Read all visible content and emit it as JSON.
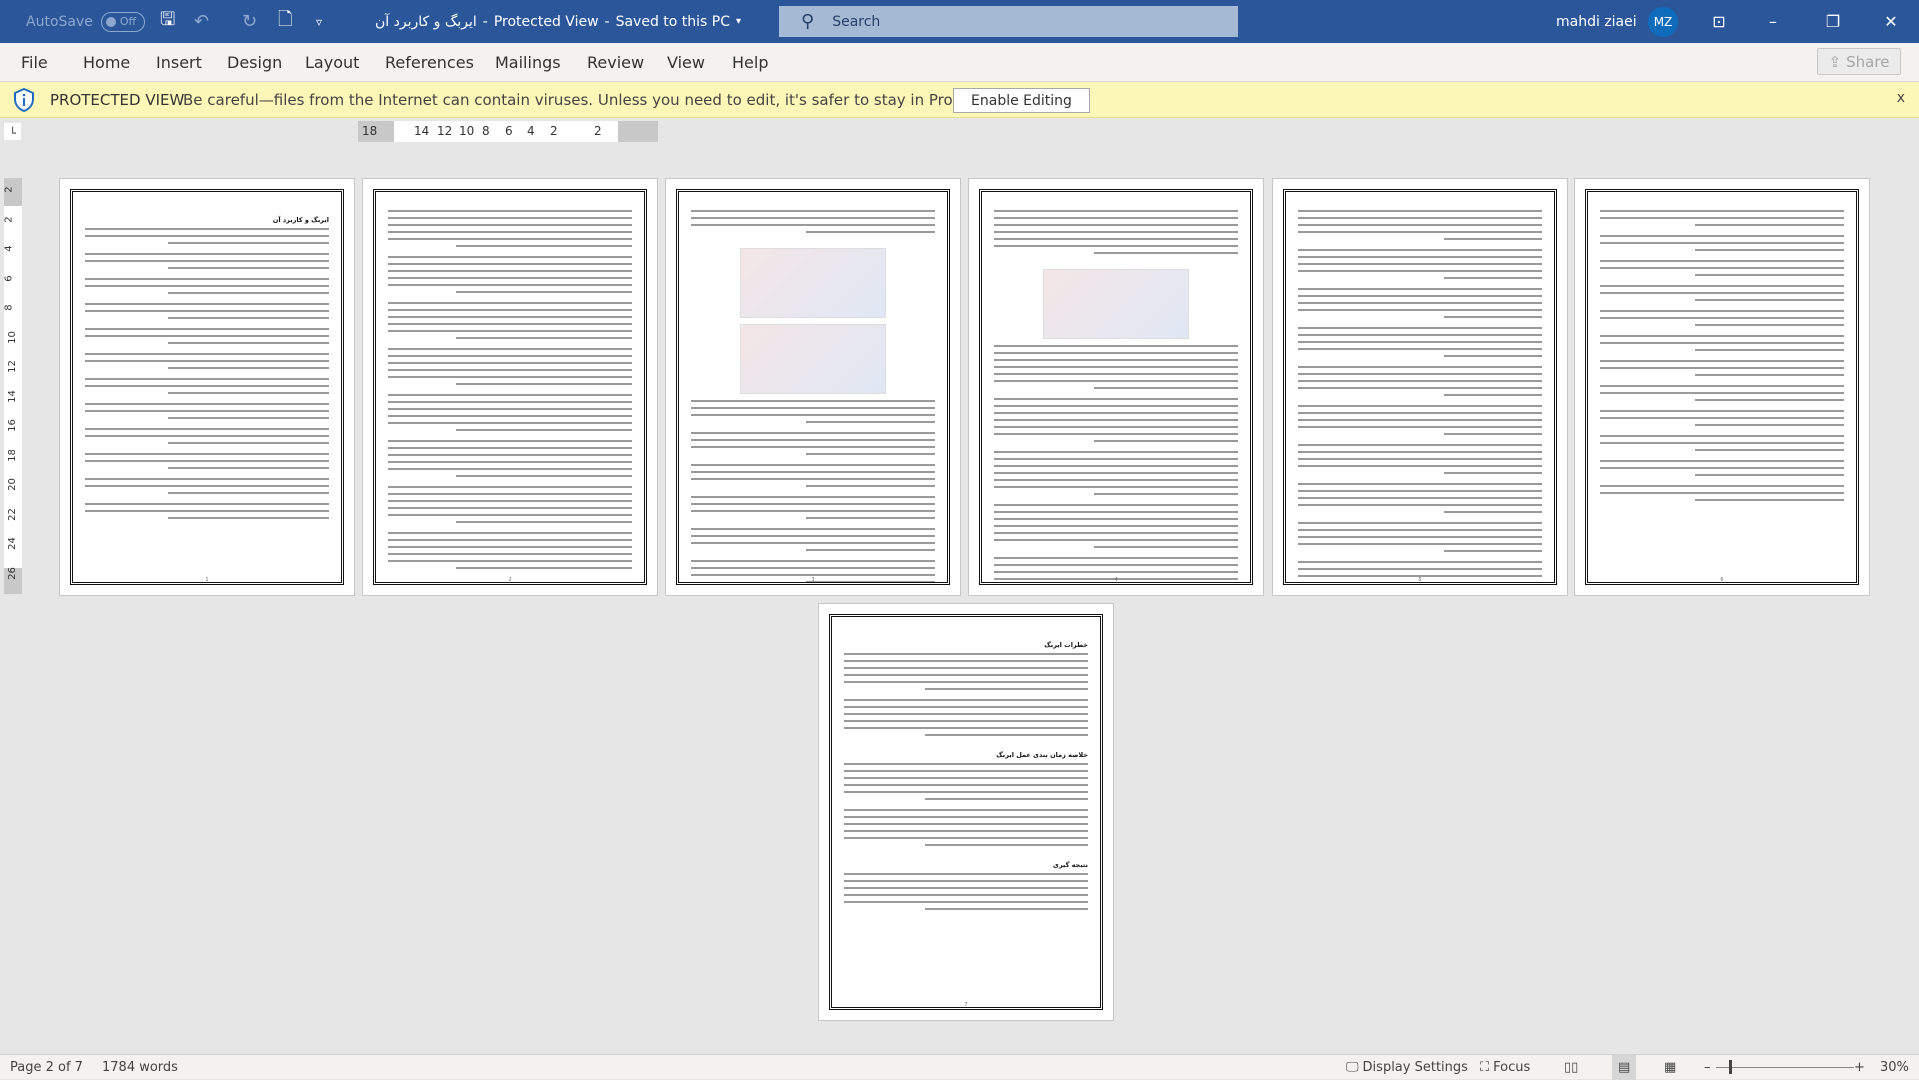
{
  "titlebar": {
    "autosave_label": "AutoSave",
    "autosave_state": "Off",
    "doc_title": "ایربگ و کاربرد آن",
    "mode": "Protected View",
    "save_state": "Saved to this PC",
    "search_placeholder": "Search",
    "user_name": "mahdi ziaei",
    "user_initials": "MZ"
  },
  "menu": {
    "items": [
      "File",
      "Home",
      "Insert",
      "Design",
      "Layout",
      "References",
      "Mailings",
      "Review",
      "View",
      "Help"
    ],
    "share_label": "Share"
  },
  "protected_view": {
    "label": "PROTECTED VIEW",
    "message": "Be careful—files from the Internet can contain viruses. Unless you need to edit, it's safer to stay in Protected View.",
    "button": "Enable Editing",
    "close": "x"
  },
  "ruler": {
    "h_ticks": [
      "18",
      "14",
      "12",
      "10",
      "8",
      "6",
      "4",
      "2",
      "2"
    ],
    "v_ticks": [
      "2",
      "2",
      "4",
      "6",
      "8",
      "10",
      "12",
      "14",
      "16",
      "18",
      "20",
      "22",
      "24",
      "26"
    ]
  },
  "pages": [
    {
      "number": "1",
      "headings": [
        "ایربگ و کاربرد آن"
      ],
      "images": 0
    },
    {
      "number": "2",
      "headings": [],
      "images": 0
    },
    {
      "number": "3",
      "headings": [],
      "images": 2
    },
    {
      "number": "4",
      "headings": [],
      "images": 1
    },
    {
      "number": "5",
      "headings": [],
      "images": 0
    },
    {
      "number": "6",
      "headings": [],
      "images": 0
    },
    {
      "number": "7",
      "headings": [
        "خطرات ایربگ",
        "خلاصه زمان بندی عمل ایربگ",
        "نتیجه گیری"
      ],
      "images": 0
    }
  ],
  "status": {
    "page": "Page 2 of 7",
    "words": "1784 words",
    "display_settings": "Display Settings",
    "focus": "Focus",
    "zoom": "30%",
    "zoom_percent": 30
  }
}
